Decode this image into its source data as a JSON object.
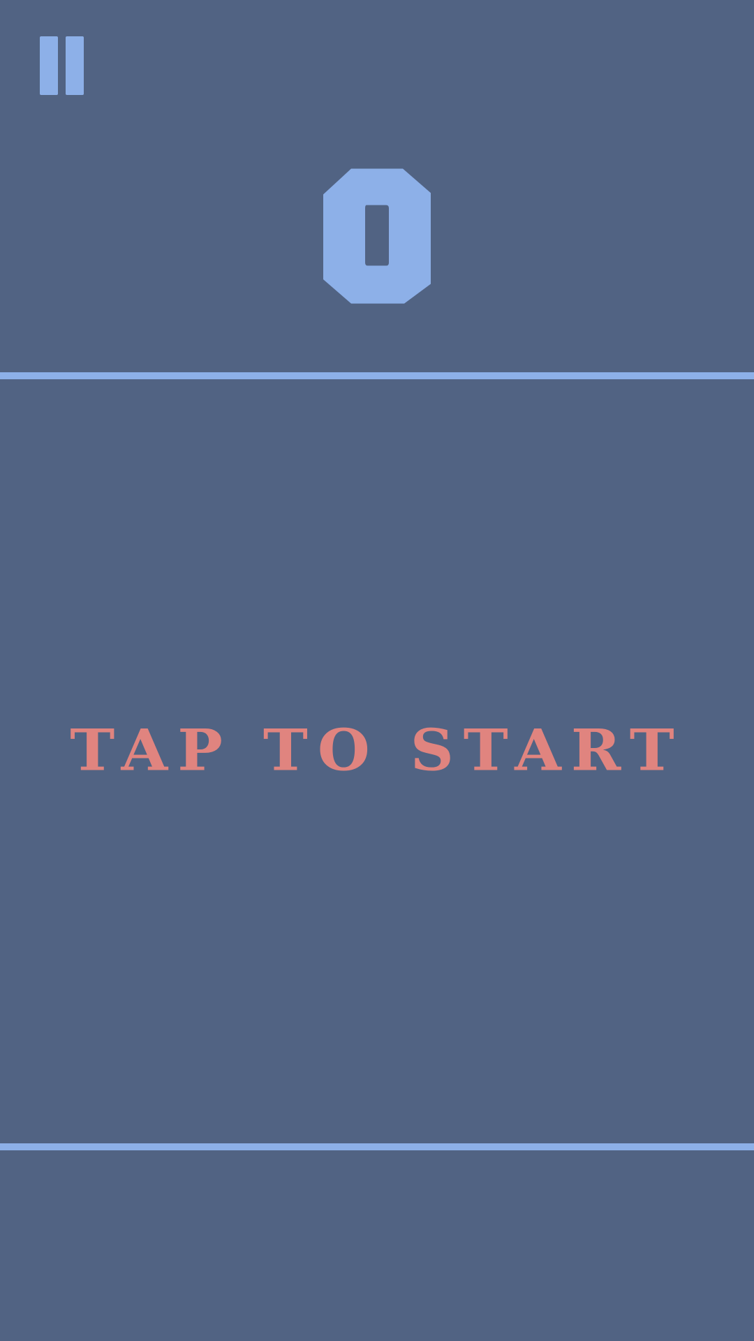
{
  "hud": {
    "score": "0",
    "pause_icon": "pause-icon"
  },
  "prompt": {
    "text": "TAP TO START"
  },
  "colors": {
    "background": "#516383",
    "accent_blue": "#8db0e8",
    "prompt_red": "#e0847f"
  }
}
